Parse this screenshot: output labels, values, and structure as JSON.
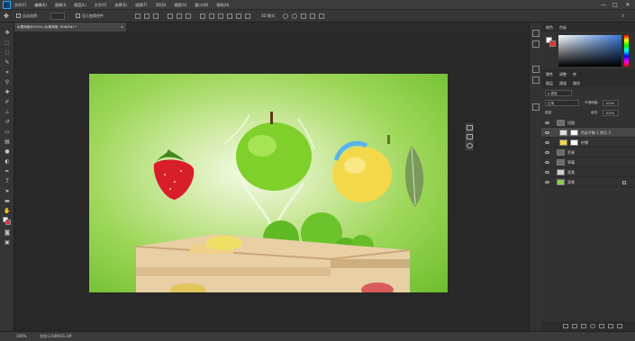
{
  "menubar": {
    "logo": "Ps",
    "items": [
      "文件(F)",
      "编辑(E)",
      "图像(I)",
      "图层(L)",
      "文字(Y)",
      "选择(S)",
      "滤镜(T)",
      "3D(D)",
      "视图(V)",
      "窗口(W)",
      "帮助(H)"
    ],
    "minimize": "—",
    "maximize": "□",
    "close": "✕"
  },
  "options": {
    "auto_select": "自动选择：",
    "auto_select_target": "组",
    "show_transform": "显示变换控件",
    "mode_3d": "3D 模式："
  },
  "document": {
    "tab_title": "水果海报@100% (水果海报, RGB/8#) *",
    "tab_close": "×"
  },
  "statusbar": {
    "zoom": "100%",
    "doc_info": "文档:2.64M/31.1M"
  },
  "panels": {
    "color_tabs": [
      "颜色",
      "色板"
    ],
    "adjust_tabs": [
      "属性",
      "调整",
      "库"
    ],
    "layers_tabs": [
      "图层",
      "通道",
      "路径"
    ],
    "filter_kind": "ρ 类型",
    "blend_mode": "正常",
    "opacity_label": "不透明度:",
    "opacity_value": "100%",
    "lock_label": "锁定:",
    "fill_label": "填充:",
    "fill_value": "100%",
    "layers": [
      {
        "name": "切图",
        "selected": false,
        "indent": 0,
        "kind": "group"
      },
      {
        "name": "色彩平衡 1 拷贝 3",
        "selected": true,
        "indent": 1,
        "kind": "adjust"
      },
      {
        "name": "柠檬",
        "selected": false,
        "indent": 1,
        "kind": "image"
      },
      {
        "name": "苹果",
        "selected": false,
        "indent": 0,
        "kind": "group"
      },
      {
        "name": "草莓",
        "selected": false,
        "indent": 0,
        "kind": "group"
      },
      {
        "name": "背景",
        "selected": false,
        "indent": 0,
        "kind": "image"
      },
      {
        "name": "背景",
        "selected": false,
        "indent": 0,
        "kind": "background"
      }
    ]
  },
  "colors": {
    "accent": "#31a8ff",
    "foreground": "#ffffff",
    "background_swatch": "#e03030",
    "canvas_green": "#7cc63a"
  }
}
